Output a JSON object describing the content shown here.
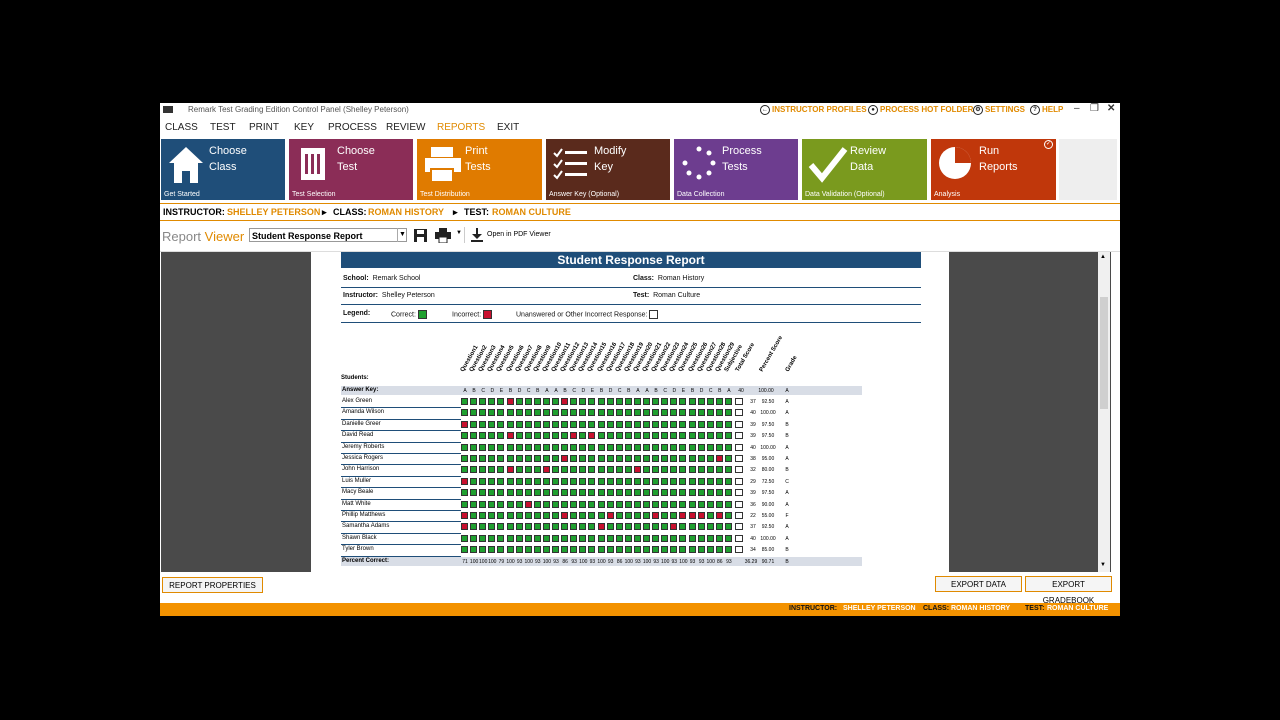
{
  "window": {
    "title": "Remark Test Grading Edition Control Panel (Shelley Peterson)"
  },
  "topbar": {
    "instructor_profiles": "INSTRUCTOR PROFILES",
    "process_hot_folder": "PROCESS HOT FOLDER",
    "settings": "SETTINGS",
    "help": "HELP"
  },
  "menu": [
    "CLASS",
    "TEST",
    "PRINT",
    "KEY",
    "PROCESS",
    "REVIEW",
    "REPORTS",
    "EXIT"
  ],
  "tiles": [
    {
      "label1": "Choose",
      "label2": "Class",
      "caption": "Get Started",
      "color": "#1f4e79",
      "icon": "house-icon"
    },
    {
      "label1": "Choose",
      "label2": "Test",
      "caption": "Test Selection",
      "color": "#8b2d57",
      "icon": "document-icon"
    },
    {
      "label1": "Print",
      "label2": "Tests",
      "caption": "Test Distribution",
      "color": "#e07b00",
      "icon": "printer-icon"
    },
    {
      "label1": "Modify",
      "label2": "Key",
      "caption": "Answer Key (Optional)",
      "color": "#5a2a1c",
      "icon": "checklist-icon"
    },
    {
      "label1": "Process",
      "label2": "Tests",
      "caption": "Data Collection",
      "color": "#6d3d8f",
      "icon": "spinner-icon"
    },
    {
      "label1": "Review",
      "label2": "Data",
      "caption": "Data Validation (Optional)",
      "color": "#7a9a1e",
      "icon": "checkmark-icon"
    },
    {
      "label1": "Run",
      "label2": "Reports",
      "caption": "Analysis",
      "color": "#c0370b",
      "icon": "pie-icon"
    }
  ],
  "breadcrumb": {
    "instructor_label": "INSTRUCTOR:",
    "instructor": "SHELLEY PETERSON",
    "class_label": "CLASS:",
    "class": "ROMAN HISTORY",
    "test_label": "TEST:",
    "test": "ROMAN CULTURE"
  },
  "viewer": {
    "title_a": "Report ",
    "title_b": "Viewer",
    "selected_report": "Student Response Report",
    "open_pdf": "Open in PDF Viewer"
  },
  "report": {
    "title": "Student Response Report",
    "school_label": "School:",
    "school": "Remark School",
    "class_label": "Class:",
    "class": "Roman History",
    "instructor_label": "Instructor:",
    "instructor": "Shelley Peterson",
    "test_label": "Test:",
    "test": "Roman Culture",
    "legend_label": "Legend:",
    "legend_correct": "Correct:",
    "legend_incorrect": "Incorrect:",
    "legend_unanswered": "Unanswered or Other Incorrect Response:",
    "students_label": "Students:",
    "answer_key_label": "Answer Key:",
    "percent_correct_label": "Percent Correct:",
    "col_total": "Total Score",
    "col_percent": "Percent Score",
    "col_grade": "Grade",
    "questions": [
      "Question1",
      "Question2",
      "Question3",
      "Question4",
      "Question5",
      "Question6",
      "Question7",
      "Question8",
      "Question9",
      "Question10",
      "Question11",
      "Question12",
      "Question13",
      "Question14",
      "Question15",
      "Question16",
      "Question17",
      "Question18",
      "Question19",
      "Question20",
      "Question21",
      "Question22",
      "Question23",
      "Question24",
      "Question25",
      "Question26",
      "Question27",
      "Question28",
      "Question29",
      "Subjective"
    ],
    "answer_key": [
      "A",
      "B",
      "C",
      "D",
      "E",
      "B",
      "D",
      "C",
      "B",
      "A",
      "A",
      "B",
      "C",
      "D",
      "E",
      "B",
      "D",
      "C",
      "B",
      "A",
      "A",
      "B",
      "C",
      "D",
      "E",
      "B",
      "D",
      "C",
      "B",
      "A"
    ],
    "students": [
      {
        "name": "Alex Green",
        "wrong": [
          5,
          11
        ],
        "total": "37",
        "pct": "92.50",
        "grade": "A"
      },
      {
        "name": "Amanda Wilson",
        "wrong": [],
        "total": "40",
        "pct": "100.00",
        "grade": "A"
      },
      {
        "name": "Danielle Greer",
        "wrong": [
          0
        ],
        "total": "39",
        "pct": "97.50",
        "grade": "B"
      },
      {
        "name": "David Read",
        "wrong": [
          5,
          12,
          14
        ],
        "total": "39",
        "pct": "97.50",
        "grade": "B"
      },
      {
        "name": "Jeremy Roberts",
        "wrong": [],
        "total": "40",
        "pct": "100.00",
        "grade": "A"
      },
      {
        "name": "Jessica Rogers",
        "wrong": [
          11,
          28
        ],
        "total": "38",
        "pct": "95.00",
        "grade": "A"
      },
      {
        "name": "John Harrison",
        "wrong": [
          5,
          9,
          19
        ],
        "total": "32",
        "pct": "80.00",
        "grade": "B"
      },
      {
        "name": "Luis Muller",
        "wrong": [
          0
        ],
        "total": "29",
        "pct": "72.50",
        "grade": "C"
      },
      {
        "name": "Macy Beale",
        "wrong": [],
        "total": "39",
        "pct": "97.50",
        "grade": "A"
      },
      {
        "name": "Matt White",
        "wrong": [
          7
        ],
        "total": "36",
        "pct": "90.00",
        "grade": "A"
      },
      {
        "name": "Phillip Matthews",
        "wrong": [
          0,
          11,
          16,
          21,
          24,
          25,
          26,
          28
        ],
        "total": "22",
        "pct": "55.00",
        "grade": "F"
      },
      {
        "name": "Samantha Adams",
        "wrong": [
          0,
          15,
          23
        ],
        "total": "37",
        "pct": "92.50",
        "grade": "A"
      },
      {
        "name": "Shawn Black",
        "wrong": [],
        "total": "40",
        "pct": "100.00",
        "grade": "A"
      },
      {
        "name": "Tyler Brown",
        "wrong": [],
        "total": "34",
        "pct": "85.00",
        "grade": "B"
      }
    ],
    "key_total": "40",
    "key_pct": "100.00",
    "key_grade": "A",
    "percent_correct": [
      "71",
      "100",
      "100",
      "100",
      "79",
      "100",
      "93",
      "100",
      "93",
      "100",
      "93",
      "86",
      "93",
      "100",
      "93",
      "100",
      "93",
      "86",
      "100",
      "93",
      "100",
      "93",
      "100",
      "93",
      "100",
      "93",
      "93",
      "100",
      "86",
      "93"
    ],
    "avg_total": "36.29",
    "avg_pct": "90.71",
    "avg_grade": "B"
  },
  "buttons": {
    "report_properties": "REPORT PROPERTIES",
    "export_data": "EXPORT DATA",
    "export_gradebook": "EXPORT GRADEBOOK"
  },
  "status": {
    "instructor_label": "INSTRUCTOR:",
    "instructor": "SHELLEY PETERSON",
    "class_label": "CLASS:",
    "class": "ROMAN HISTORY",
    "test_label": "TEST:",
    "test": "ROMAN CULTURE"
  },
  "colors": {
    "accent": "#e08a00",
    "correct": "#1fa02f",
    "incorrect": "#c8102e",
    "header_blue": "#1f4e79"
  }
}
